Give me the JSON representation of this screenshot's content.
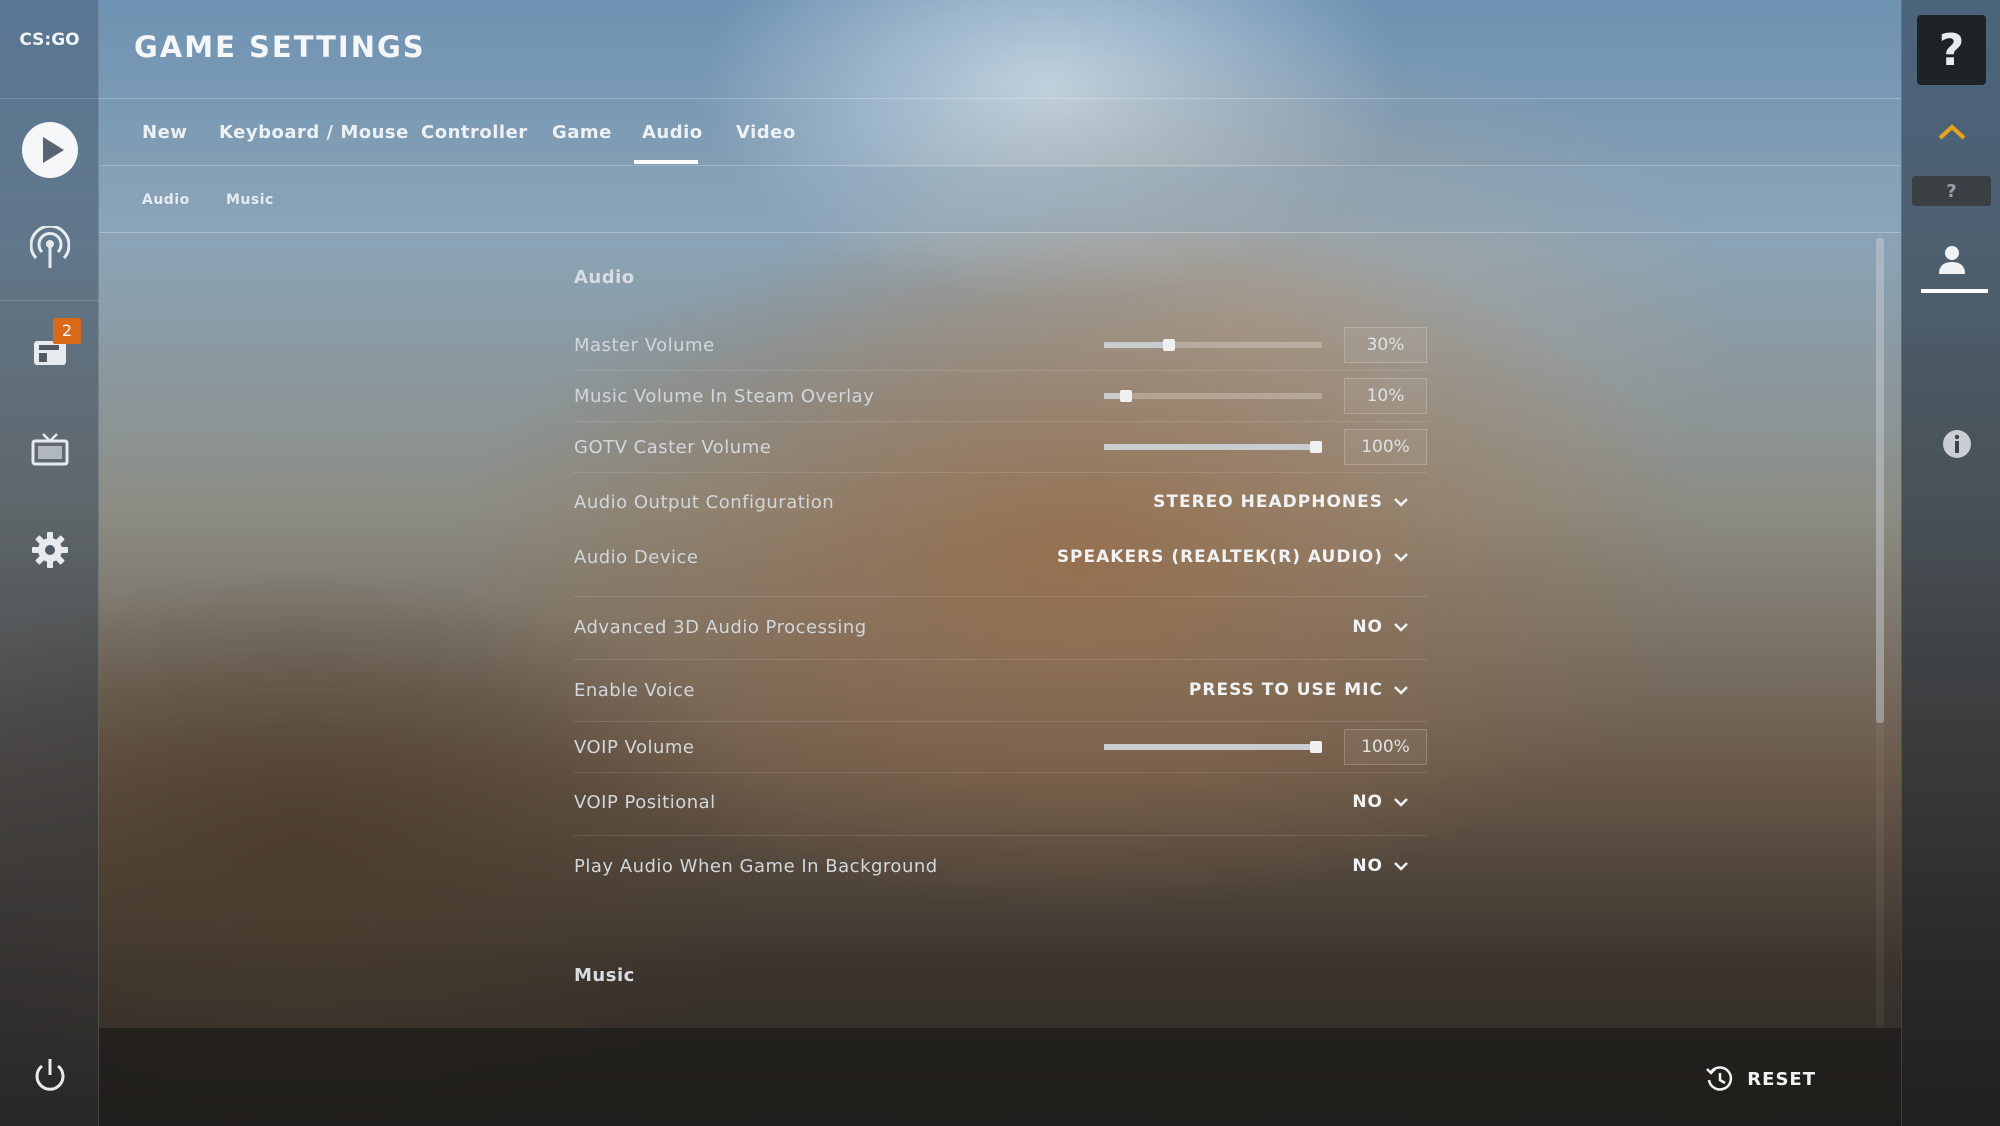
{
  "app": {
    "logo_text": "CS:GO"
  },
  "header": {
    "title": "GAME SETTINGS"
  },
  "tabs": [
    {
      "label": "New"
    },
    {
      "label": "Keyboard / Mouse"
    },
    {
      "label": "Controller"
    },
    {
      "label": "Game"
    },
    {
      "label": "Audio",
      "active": true
    },
    {
      "label": "Video"
    }
  ],
  "subtabs": [
    {
      "label": "Audio"
    },
    {
      "label": "Music"
    }
  ],
  "left_nav": {
    "inventory_badge": "2"
  },
  "sections": {
    "audio_title": "Audio",
    "music_title": "Music"
  },
  "rows": {
    "master_volume": {
      "label": "Master Volume",
      "value": "30%",
      "level": 0.3
    },
    "music_volume_overlay": {
      "label": "Music Volume In Steam Overlay",
      "value": "10%",
      "level": 0.1
    },
    "gotv_caster_volume": {
      "label": "GOTV Caster Volume",
      "value": "100%",
      "level": 1.0
    },
    "audio_output_config": {
      "label": "Audio Output Configuration",
      "value": "STEREO HEADPHONES"
    },
    "audio_device": {
      "label": "Audio Device",
      "value": "SPEAKERS (REALTEK(R) AUDIO)"
    },
    "advanced_3d_audio": {
      "label": "Advanced 3D Audio Processing",
      "value": "NO"
    },
    "enable_voice": {
      "label": "Enable Voice",
      "value": "PRESS TO USE MIC"
    },
    "voip_volume": {
      "label": "VOIP Volume",
      "value": "100%",
      "level": 1.0
    },
    "voip_positional": {
      "label": "VOIP Positional",
      "value": "NO"
    },
    "play_audio_background": {
      "label": "Play Audio When Game In Background",
      "value": "NO"
    }
  },
  "bottom_bar": {
    "reset_label": "RESET"
  },
  "right_panel": {
    "help_glyph": "?",
    "small_help_glyph": "?"
  },
  "icons": {
    "play": "play-icon",
    "broadcast": "broadcast-icon",
    "inventory": "inventory-icon",
    "watch": "tv-icon",
    "settings": "gear-icon",
    "power": "power-icon",
    "reset": "history-icon",
    "chevron_up": "chevron-up-icon",
    "profile": "user-icon",
    "info": "info-icon"
  }
}
